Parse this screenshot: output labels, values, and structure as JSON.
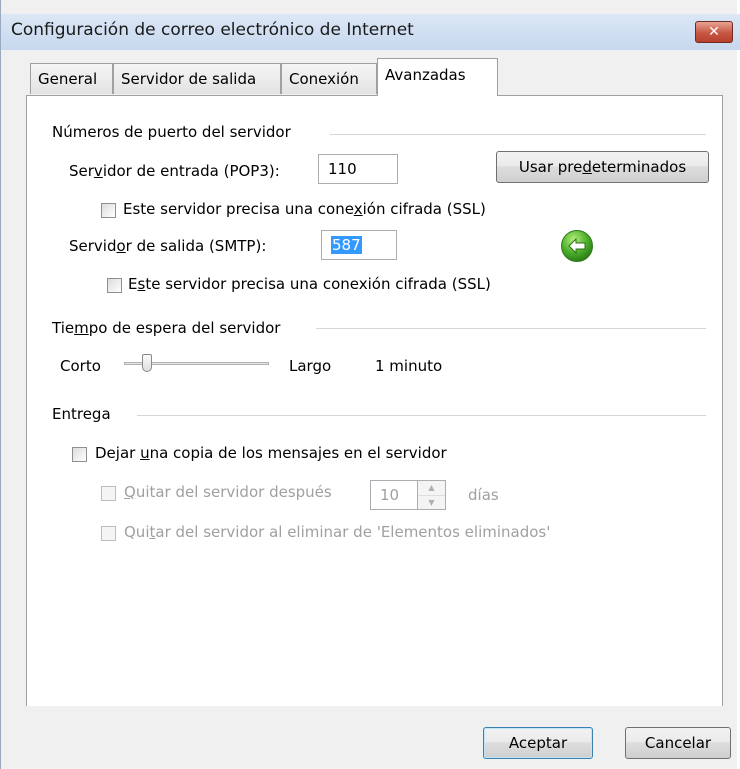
{
  "window": {
    "title": "Configuración de correo electrónico de Internet",
    "close_glyph": "✕"
  },
  "tabs": [
    {
      "label": "General",
      "active": false
    },
    {
      "label": "Servidor de salida",
      "active": false
    },
    {
      "label": "Conexión",
      "active": false
    },
    {
      "label": "Avanzadas",
      "active": true
    }
  ],
  "ports": {
    "heading": "Números de puerto del servidor",
    "incoming_label_pre": "Ser",
    "incoming_label_key": "v",
    "incoming_label_post": "idor de entrada (POP3):",
    "incoming_value": "110",
    "defaults_button_pre": "Usar pre",
    "defaults_button_key": "d",
    "defaults_button_post": "eterminados",
    "incoming_ssl_pre": "Este servidor precisa una cone",
    "incoming_ssl_key": "x",
    "incoming_ssl_post": "ión cifrada (SSL)",
    "outgoing_label_pre": "Servid",
    "outgoing_label_key": "o",
    "outgoing_label_post": "r de salida (SMTP):",
    "outgoing_value": "587",
    "outgoing_ssl_pre": "E",
    "outgoing_ssl_key": "s",
    "outgoing_ssl_post": "te servidor precisa una conexión cifrada (SSL)"
  },
  "timeout": {
    "heading_pre": "Tie",
    "heading_key": "m",
    "heading_post": "po de espera del servidor",
    "short_label": "Corto",
    "long_label": "Largo",
    "value_text": "1 minuto"
  },
  "delivery": {
    "heading": "Entrega",
    "leave_copy_pre": "Dejar ",
    "leave_copy_key": "u",
    "leave_copy_post": "na copia de los mensajes en el servidor",
    "remove_after_pre": "",
    "remove_after_key": "Q",
    "remove_after_post": "uitar del servidor después",
    "days_value": "10",
    "days_unit": "días",
    "remove_deleted_pre": "Qui",
    "remove_deleted_key": "t",
    "remove_deleted_post": "ar del servidor al eliminar de 'Elementos eliminados'"
  },
  "buttons": {
    "ok": "Aceptar",
    "cancel": "Cancelar"
  },
  "colors": {
    "accent": "#3399ff",
    "arrow_green": "#4caf2a"
  }
}
